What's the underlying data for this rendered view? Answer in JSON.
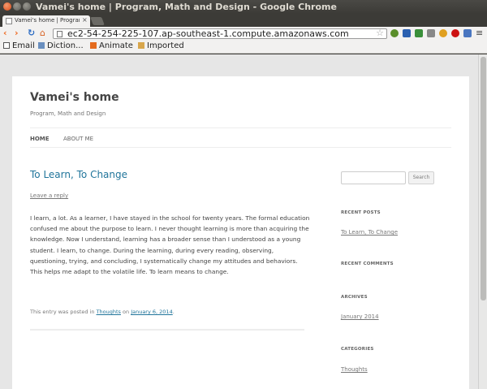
{
  "window": {
    "title": "Vamei's home | Program, Math and Design - Google Chrome"
  },
  "tab": {
    "label": "Vamei's home | Program...",
    "close_glyph": "×"
  },
  "toolbar": {
    "back_glyph": "‹",
    "forward_glyph": "›",
    "reload_glyph": "↻",
    "home_glyph": "⌂",
    "url": "ec2-54-254-225-107.ap-southeast-1.compute.amazonaws.com",
    "star_glyph": "☆",
    "menu_glyph": "≡"
  },
  "bookmarks": [
    {
      "label": "Email",
      "icon": "page-icon"
    },
    {
      "label": "Diction...",
      "icon": "dictionary-icon"
    },
    {
      "label": "Animate",
      "icon": "animate-icon"
    },
    {
      "label": "Imported",
      "icon": "folder-icon"
    }
  ],
  "site": {
    "title": "Vamei's home",
    "description": "Program, Math and Design",
    "nav": [
      "HOME",
      "ABOUT ME"
    ]
  },
  "post": {
    "title": "To Learn, To Change",
    "reply": "Leave a reply",
    "body": "I learn, a lot. As a learner, I have stayed in the school for twenty years. The formal education confused me about the purpose to learn. I never thought learning is more than acquiring the knowledge. Now I understand, learning has a broader sense than I understood as a young student. I learn, to change. During the learning, during every reading, observing, questioning, trying, and concluding, I systematically change my attitudes and behaviors. This helps me adapt to the volatile life. To learn means to change.",
    "meta_prefix": "This entry was posted in ",
    "category": "Thoughts",
    "meta_on": " on ",
    "date": "January 6, 2014",
    "meta_suffix": "."
  },
  "sidebar": {
    "search_button": "Search",
    "recent_posts_title": "RECENT POSTS",
    "recent_post": "To Learn, To Change",
    "recent_comments_title": "RECENT COMMENTS",
    "archives_title": "ARCHIVES",
    "archive": "January 2014",
    "categories_title": "CATEGORIES",
    "category": "Thoughts"
  },
  "colors": {
    "link": "#21759b",
    "chrome_dark": "#3c3b37",
    "close_button": "#df4a16"
  }
}
